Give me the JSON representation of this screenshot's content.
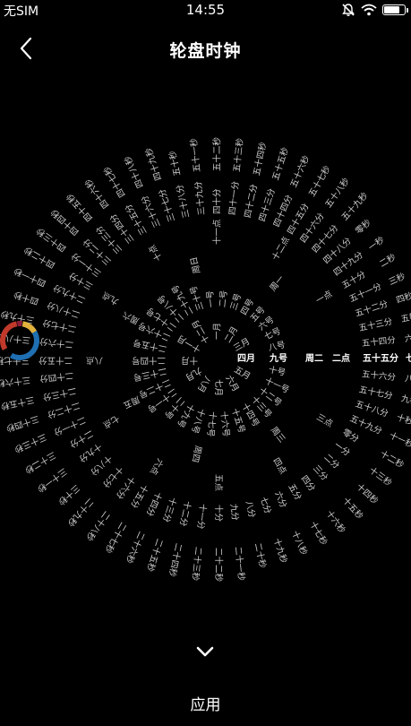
{
  "status_bar": {
    "carrier": "无SIM",
    "time": "14:55",
    "icons": [
      "mute-icon",
      "wifi-icon",
      "battery-icon"
    ]
  },
  "nav": {
    "back_icon": "chevron-left-icon",
    "title": "轮盘时钟"
  },
  "clock": {
    "current": {
      "month": "四月",
      "day": "九号",
      "weekday": "周二",
      "hour": "二点",
      "minute": "五十五分",
      "second": "七秒"
    },
    "months": [
      "一月",
      "二月",
      "三月",
      "四月",
      "五月",
      "六月",
      "七月",
      "八月",
      "九月",
      "十月",
      "十一月",
      "十二月"
    ],
    "days": [
      "一号",
      "二号",
      "三号",
      "四号",
      "五号",
      "六号",
      "七号",
      "八号",
      "九号",
      "十号",
      "十一号",
      "十二号",
      "十三号",
      "十四号",
      "十五号",
      "十六号",
      "十七号",
      "十八号",
      "十九号",
      "二十号",
      "二十一号",
      "二十二号",
      "二十三号",
      "二十四号",
      "二十五号",
      "二十六号",
      "二十七号",
      "二十八号",
      "二十九号",
      "三十号"
    ],
    "weekdays": [
      "周一",
      "周二",
      "周三",
      "周四",
      "周五",
      "周六",
      "周日"
    ],
    "hours": [
      "一点",
      "二点",
      "三点",
      "四点",
      "五点",
      "六点",
      "七点",
      "八点",
      "九点",
      "十点",
      "十一点",
      "十二点"
    ],
    "minutes": [
      "一分",
      "二分",
      "三分",
      "四分",
      "五分",
      "六分",
      "七分",
      "八分",
      "九分",
      "十分",
      "十一分",
      "十二分",
      "十三分",
      "十四分",
      "十五分",
      "十六分",
      "十七分",
      "十八分",
      "十九分",
      "二十分",
      "二十一分",
      "二十二分",
      "二十三分",
      "二十四分",
      "二十五分",
      "二十六分",
      "二十七分",
      "二十八分",
      "二十九分",
      "三十分",
      "三十一分",
      "三十二分",
      "三十三分",
      "三十四分",
      "三十五分",
      "三十六分",
      "三十七分",
      "三十八分",
      "三十九分",
      "四十分",
      "四十一分",
      "四十二分",
      "四十三分",
      "四十四分",
      "四十五分",
      "四十六分",
      "四十七分",
      "四十八分",
      "四十九分",
      "五十分",
      "五十一分",
      "五十二分",
      "五十三分",
      "五十四分",
      "五十五分",
      "五十六分",
      "五十七分",
      "五十八分",
      "五十九分",
      "零分"
    ],
    "seconds": [
      "一秒",
      "二秒",
      "三秒",
      "四秒",
      "五秒",
      "六秒",
      "七秒",
      "八秒",
      "九秒",
      "十秒",
      "十一秒",
      "十二秒",
      "十三秒",
      "十四秒",
      "十五秒",
      "十六秒",
      "十七秒",
      "十八秒",
      "十九秒",
      "二十秒",
      "二十一秒",
      "二十二秒",
      "二十三秒",
      "二十四秒",
      "二十五秒",
      "二十六秒",
      "二十七秒",
      "二十八秒",
      "二十九秒",
      "三十秒",
      "三十一秒",
      "三十二秒",
      "三十三秒",
      "三十四秒",
      "三十五秒",
      "三十六秒",
      "三十七秒",
      "三十八秒",
      "三十九秒",
      "四十秒",
      "四十一秒",
      "四十二秒",
      "四十三秒",
      "四十四秒",
      "四十五秒",
      "四十六秒",
      "四十七秒",
      "四十八秒",
      "四十九秒",
      "五十秒",
      "五十一秒",
      "五十二秒",
      "五十三秒",
      "五十四秒",
      "五十五秒",
      "五十六秒",
      "五十七秒",
      "五十八秒",
      "五十九秒",
      "零秒"
    ]
  },
  "logo_colors": [
    "#c0392b",
    "#e0b23c",
    "#1f6fb2",
    "#8e1e3a"
  ],
  "footer": {
    "collapse_icon": "chevron-down-icon",
    "apply_label": "应用"
  },
  "colors": {
    "background": "#000000",
    "text": "#ffffff",
    "dim_text": "#cfcfcf"
  }
}
